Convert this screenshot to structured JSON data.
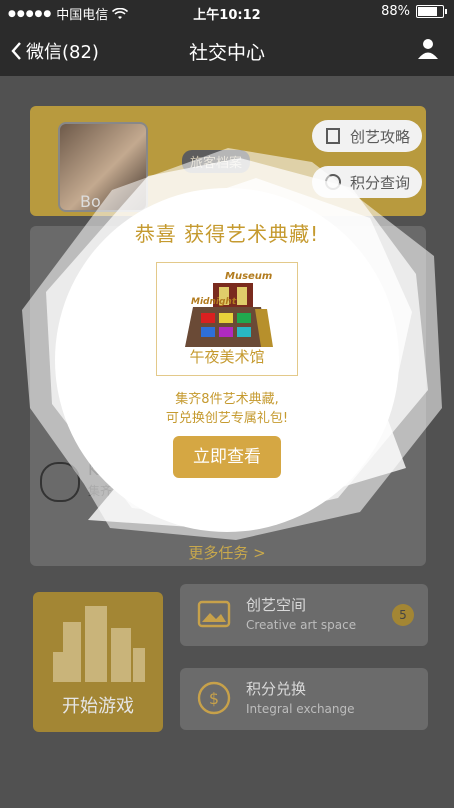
{
  "status_bar": {
    "carrier": "中国电信",
    "time": "上午10:12",
    "battery": "88%",
    "battery_level": 0.88
  },
  "nav": {
    "back_label": "微信(82)",
    "title": "社交中心"
  },
  "profile": {
    "name_partial": "Bo",
    "archive_tag": "旅客档案",
    "guide_button": "创艺攻略",
    "points_button": "积分查询"
  },
  "tasks": {
    "more_label": "更多任务 >",
    "peek_label": "K",
    "peek_desc": "集齐"
  },
  "start_game": {
    "label": "开始游戏"
  },
  "creative_space": {
    "title": "创艺空间",
    "subtitle": "Creative art space",
    "badge": "5"
  },
  "integral_exchange": {
    "title": "积分兑换",
    "subtitle": "Integral exchange"
  },
  "popup": {
    "title": "恭喜 获得艺术典藏!",
    "museum_sign_top": "Museum",
    "museum_sign_left": "Midnight",
    "museum_name": "午夜美术馆",
    "desc_line1": "集齐8件艺术典藏,",
    "desc_line2": "可兑换创艺专属礼包!",
    "cta": "立即查看"
  },
  "colors": {
    "gold": "#c59a2f",
    "gold_button": "#d5a743",
    "dark_bar": "#2b2b2b"
  }
}
